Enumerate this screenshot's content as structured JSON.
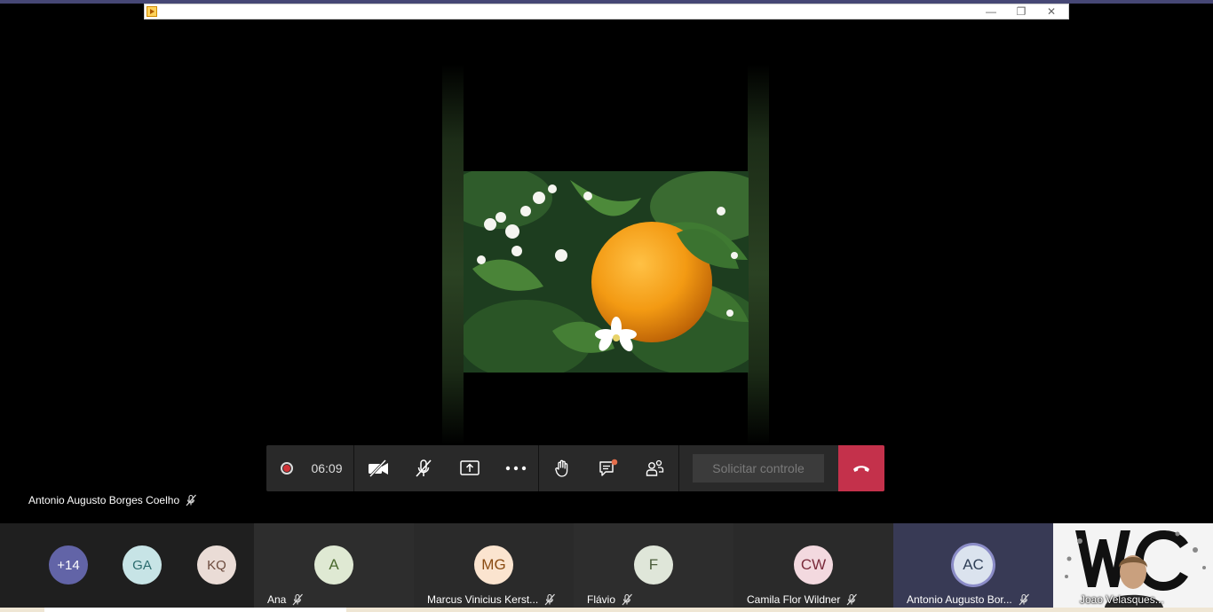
{
  "window": {
    "minimize": "—",
    "maximize": "❐",
    "close": "✕"
  },
  "controls": {
    "timer": "06:09",
    "request_control": "Solicitar controle"
  },
  "main_speaker": {
    "name": "Antonio Augusto Borges Coelho"
  },
  "gallery": {
    "overflow": {
      "label": "+14",
      "color": "#6264a7"
    },
    "small": [
      {
        "initials": "GA",
        "bg": "#c7e4e6",
        "fg": "#2b6b6e"
      },
      {
        "initials": "KQ",
        "bg": "#eadcd6",
        "fg": "#6b4a3d"
      }
    ],
    "tiles": [
      {
        "initials": "A",
        "name": "Ana",
        "bg": "#dfe9d3",
        "fg": "#4b6a2e",
        "tile_bg": "#2d2d2d"
      },
      {
        "initials": "MG",
        "name": "Marcus Vinicius Kerst...",
        "bg": "#fbe4cf",
        "fg": "#8a4b12",
        "tile_bg": "#2a2a2a"
      },
      {
        "initials": "F",
        "name": "Flávio",
        "bg": "#dfe6d9",
        "fg": "#4b5c3b",
        "tile_bg": "#2d2d2d"
      },
      {
        "initials": "CW",
        "name": "Camila Flor Wildner",
        "bg": "#f3d9df",
        "fg": "#7a2b3b",
        "tile_bg": "#2a2a2a"
      },
      {
        "initials": "AC",
        "name": "Antonio Augusto Bor...",
        "bg": "#dbe3ee",
        "fg": "#2f3f57",
        "tile_bg": "#383a55"
      }
    ],
    "self": {
      "name": "Joao Velasques..."
    }
  },
  "colors": {
    "hangup": "#c4314b",
    "accent": "#6264a7"
  }
}
